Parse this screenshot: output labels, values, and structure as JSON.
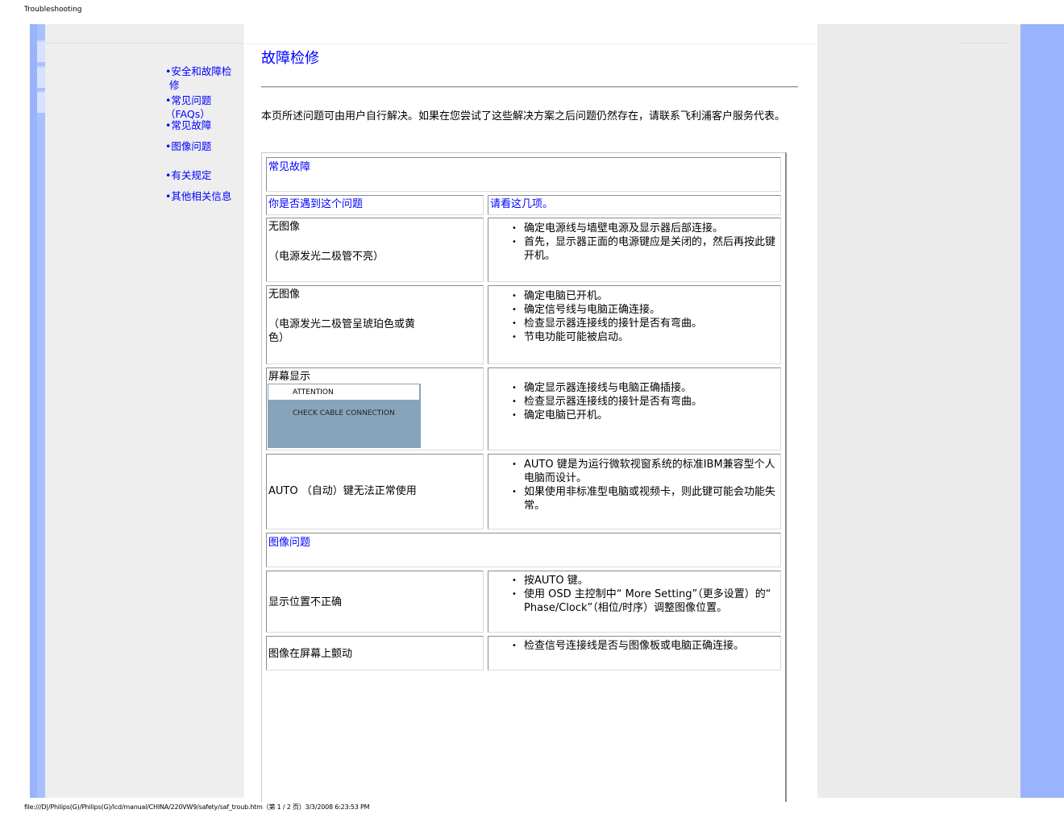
{
  "browser": {
    "header_title": "Troubleshooting",
    "footer_path": "file:///D|/Philips(G)/Philips(G)/lcd/manual/CHINA/220VW9/safety/saf_troub.htm（第 1 / 2 页）3/3/2008 6:23:53 PM"
  },
  "nav": {
    "items": [
      {
        "line1": "•安全和故障检",
        "line2": "修"
      },
      {
        "line1": "•常见问题",
        "line2": "（FAQs）"
      },
      {
        "line1": "•常见故障",
        "line2": ""
      },
      {
        "line1": "•图像问题",
        "line2": ""
      },
      {
        "line1": "•有关规定",
        "line2": ""
      },
      {
        "line1": "•其他相关信息",
        "line2": ""
      }
    ]
  },
  "main": {
    "title": "故障检修",
    "intro": "本页所述问题可由用户自行解决。如果在您尝试了这些解决方案之后问题仍然存在，请联系飞利浦客户服务代表。",
    "section1_title": "常见故障",
    "col_question": "你是否遇到这个问题",
    "col_answer": "请看这几项。",
    "rows": [
      {
        "q1": "无图像",
        "q2": "（电源发光二极管不亮）",
        "a": [
          "确定电源线与墙壁电源及显示器后部连接。",
          "首先，显示器正面的电源键应是关闭的，然后再按此键开机。"
        ]
      },
      {
        "q1": "无图像",
        "q2": "（电源发光二极管呈琥珀色或黄色）",
        "a": [
          "确定电脑已开机。",
          "确定信号线与电脑正确连接。",
          "检查显示器连接线的接针是否有弯曲。",
          "节电功能可能被启动。"
        ]
      },
      {
        "q1": "屏幕显示",
        "osd_attention": "ATTENTION",
        "osd_message": "CHECK CABLE CONNECTION",
        "a": [
          "确定显示器连接线与电脑正确插接。",
          "检查显示器连接线的接针是否有弯曲。",
          "确定电脑已开机。"
        ]
      },
      {
        "q1": "AUTO （自动）键无法正常使用",
        "a": [
          "AUTO 键是为运行微软视窗系统的标准IBM兼容型个人电脑而设计。",
          "如果使用非标准型电脑或视频卡，则此键可能会功能失常。"
        ]
      }
    ],
    "section2_title": "图像问题",
    "rows2": [
      {
        "q1": "显示位置不正确",
        "a": [
          "按AUTO 键。",
          "使用 OSD 主控制中“ More Setting”（更多设置）的“ Phase/Clock”（相位/时序）调整图像位置。"
        ]
      },
      {
        "q1": "图像在屏幕上颤动",
        "a": [
          "检查信号连接线是否与图像板或电脑正确连接。"
        ]
      }
    ]
  }
}
